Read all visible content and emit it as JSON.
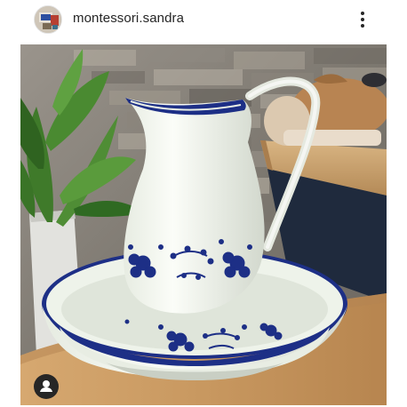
{
  "post": {
    "username": "montessori.sandra",
    "icons": {
      "more": "more-vertical-icon",
      "tagged_user": "user-tag-icon"
    }
  },
  "colors": {
    "enamel_white": "#f3f6ef",
    "enamel_blue": "#1d2f86",
    "wood": "#c89a62",
    "text": "#262626"
  }
}
